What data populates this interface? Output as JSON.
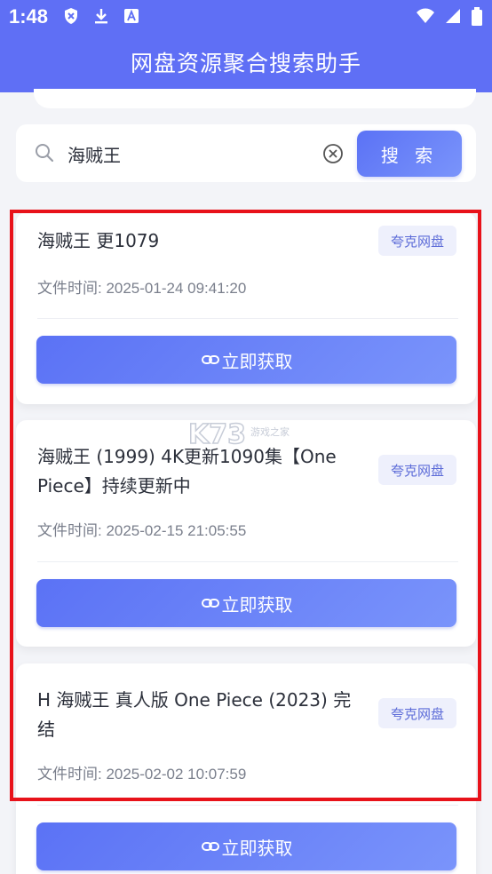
{
  "status_bar": {
    "time": "1:48",
    "left_icons": [
      "shield-icon",
      "download-icon",
      "a-icon"
    ],
    "right_icons": [
      "wifi-icon",
      "signal-icon",
      "battery-icon"
    ]
  },
  "header": {
    "title": "网盘资源聚合搜索助手"
  },
  "search": {
    "value": "海贼王",
    "button_label": "搜 索"
  },
  "results": [
    {
      "title": "海贼王 更1079",
      "tag": "夸克网盘",
      "time": "文件时间: 2025-01-24 09:41:20",
      "button_label": "立即获取"
    },
    {
      "title": "海贼王 (1999) 4K更新1090集【One Piece】持续更新中",
      "tag": "夸克网盘",
      "time": "文件时间: 2025-02-15 21:05:55",
      "button_label": "立即获取"
    },
    {
      "title": "H 海贼王 真人版 One Piece (2023) 完结",
      "tag": "夸克网盘",
      "time": "文件时间: 2025-02-02 10:07:59",
      "button_label": "立即获取"
    }
  ],
  "watermark": {
    "main": "K73",
    "sub": "游戏之家"
  },
  "colors": {
    "primary": "#5f6ff5",
    "highlight": "#e8121a",
    "tag_bg": "#eef0fc",
    "tag_text": "#5c6bd8"
  }
}
